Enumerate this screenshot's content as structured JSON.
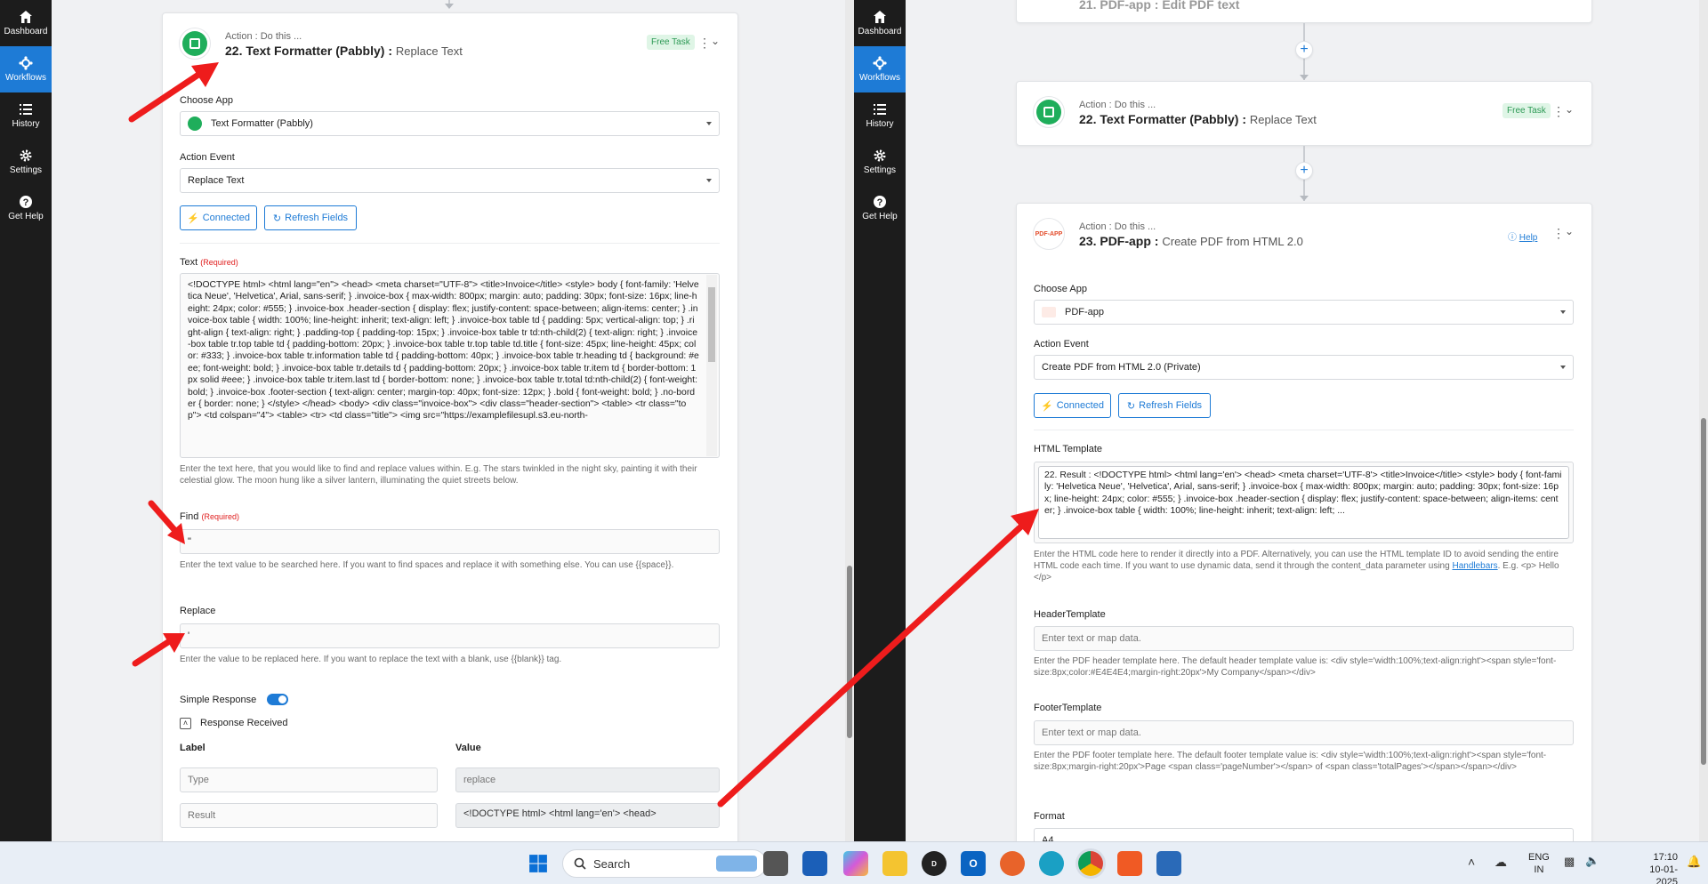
{
  "sidebar": {
    "items": [
      {
        "label": "Dashboard",
        "icon": "home-icon"
      },
      {
        "label": "Workflows",
        "icon": "workflow-icon",
        "active": true
      },
      {
        "label": "History",
        "icon": "list-icon"
      },
      {
        "label": "Settings",
        "icon": "gear-icon"
      },
      {
        "label": "Get Help",
        "icon": "question-icon"
      }
    ]
  },
  "left": {
    "step": {
      "subtitle": "Action : Do this ...",
      "title": "22. Text Formatter (Pabbly) :",
      "event": "Replace Text",
      "badge": "Free Task"
    },
    "choose_app_label": "Choose App",
    "choose_app_value": "Text Formatter (Pabbly)",
    "action_event_label": "Action Event",
    "action_event_value": "Replace Text",
    "connected_label": "Connected",
    "refresh_label": "Refresh Fields",
    "text_label": "Text",
    "required": "(Required)",
    "text_value": "<!DOCTYPE html> <html lang=\"en\"> <head> <meta charset=\"UTF-8\"> <title>Invoice</title> <style> body { font-family: 'Helvetica Neue', 'Helvetica', Arial, sans-serif; } .invoice-box { max-width: 800px; margin: auto; padding: 30px; font-size: 16px; line-height: 24px; color: #555; } .invoice-box .header-section { display: flex; justify-content: space-between; align-items: center; } .invoice-box table { width: 100%; line-height: inherit; text-align: left; } .invoice-box table td { padding: 5px; vertical-align: top; } .right-align { text-align: right; } .padding-top { padding-top: 15px; } .invoice-box table tr td:nth-child(2) { text-align: right; } .invoice-box table tr.top table td { padding-bottom: 20px; } .invoice-box table tr.top table td.title { font-size: 45px; line-height: 45px; color: #333; } .invoice-box table tr.information table td { padding-bottom: 40px; } .invoice-box table tr.heading td { background: #eee; font-weight: bold; } .invoice-box table tr.details td { padding-bottom: 20px; } .invoice-box table tr.item td { border-bottom: 1px solid #eee; } .invoice-box table tr.item.last td { border-bottom: none; } .invoice-box table tr.total td:nth-child(2) { font-weight: bold; } .invoice-box .footer-section { text-align: center; margin-top: 40px; font-size: 12px; } .bold { font-weight: bold; } .no-border { border: none; } </style> </head> <body> <div class=\"invoice-box\"> <div class=\"header-section\"> <table> <tr class=\"top\"> <td colspan=\"4\"> <table> <tr> <td class=\"title\"> <img src=\"https://examplefilesupl.s3.eu-north-",
    "text_help": "Enter the text here, that you would like to find and replace values within. E.g. The stars twinkled in the night sky, painting it with their celestial glow. The moon hung like a silver lantern, illuminating the quiet streets below.",
    "find_label": "Find",
    "find_value": "\"",
    "find_help": "Enter the text value to be searched here. If you want to find spaces and replace it with something else. You can use {{space}}.",
    "replace_label": "Replace",
    "replace_value": "'",
    "replace_help": "Enter the value to be replaced here. If you want to replace the text with a blank, use {{blank}} tag.",
    "simple_response_label": "Simple Response",
    "response_received_label": "Response Received",
    "col_label": "Label",
    "col_value": "Value",
    "rows": [
      {
        "label": "Type",
        "value": "replace"
      },
      {
        "label": "Result",
        "value": "<!DOCTYPE html> <html lang='en'> <head>"
      }
    ]
  },
  "right": {
    "prev_step_title": "21. PDF-app : Edit PDF text",
    "step22": {
      "subtitle": "Action : Do this ...",
      "title": "22. Text Formatter (Pabbly) :",
      "event": "Replace Text",
      "badge": "Free Task"
    },
    "step23": {
      "subtitle": "Action : Do this ...",
      "title": "23. PDF-app :",
      "event": "Create PDF from HTML 2.0",
      "help": "Help",
      "icon_text": "PDF-APP"
    },
    "choose_app_label": "Choose App",
    "choose_app_value": "PDF-app",
    "action_event_label": "Action Event",
    "action_event_value": "Create PDF from HTML 2.0 (Private)",
    "connected_label": "Connected",
    "refresh_label": "Refresh Fields",
    "html_template_label": "HTML Template",
    "html_template_value": "22. Result : <!DOCTYPE html> <html lang='en'> <head> <meta charset='UTF-8'> <title>Invoice</title> <style> body { font-family: 'Helvetica Neue', 'Helvetica', Arial, sans-serif; } .invoice-box { max-width: 800px; margin: auto; padding: 30px; font-size: 16px; line-height: 24px; color: #555; } .invoice-box .header-section { display: flex; justify-content: space-between; align-items: center; } .invoice-box table { width: 100%; line-height: inherit; text-align: left; ...",
    "html_help_pre": "Enter the HTML code here to render it directly into a PDF. Alternatively, you can use the HTML template ID to avoid sending the entire HTML code each time. If you want to use dynamic data, send it through the content_data parameter using",
    "html_help_link": "Handlebars",
    "html_help_post": ". E.g. <p> Hello </p>",
    "header_label": "HeaderTemplate",
    "header_placeholder": "Enter text or map data.",
    "header_help": "Enter the PDF header template here. The default header template value is: <div style='width:100%;text-align:right'><span style='font-size:8px;color:#E4E4E4;margin-right:20px'>My Company</span></div>",
    "footer_label": "FooterTemplate",
    "footer_placeholder": "Enter text or map data.",
    "footer_help": "Enter the PDF footer template here. The default footer template value is: <div style='width:100%;text-align:right'><span style='font-size:8px;margin-right:20px'>Page <span class='pageNumber'></span> of <span class='totalPages'></span></span></div>",
    "format_label": "Format",
    "format_value": "A4"
  },
  "taskbar": {
    "search_label": "Search",
    "lang": "ENG",
    "region": "IN",
    "time": "17:10",
    "date": "10-01-2025"
  },
  "colors": {
    "accent": "#1e7bd6",
    "sidebar": "#1c1c1c",
    "annotation": "#ee1c1c",
    "badge_bg": "#dff5e6",
    "badge_fg": "#2e9a56"
  }
}
